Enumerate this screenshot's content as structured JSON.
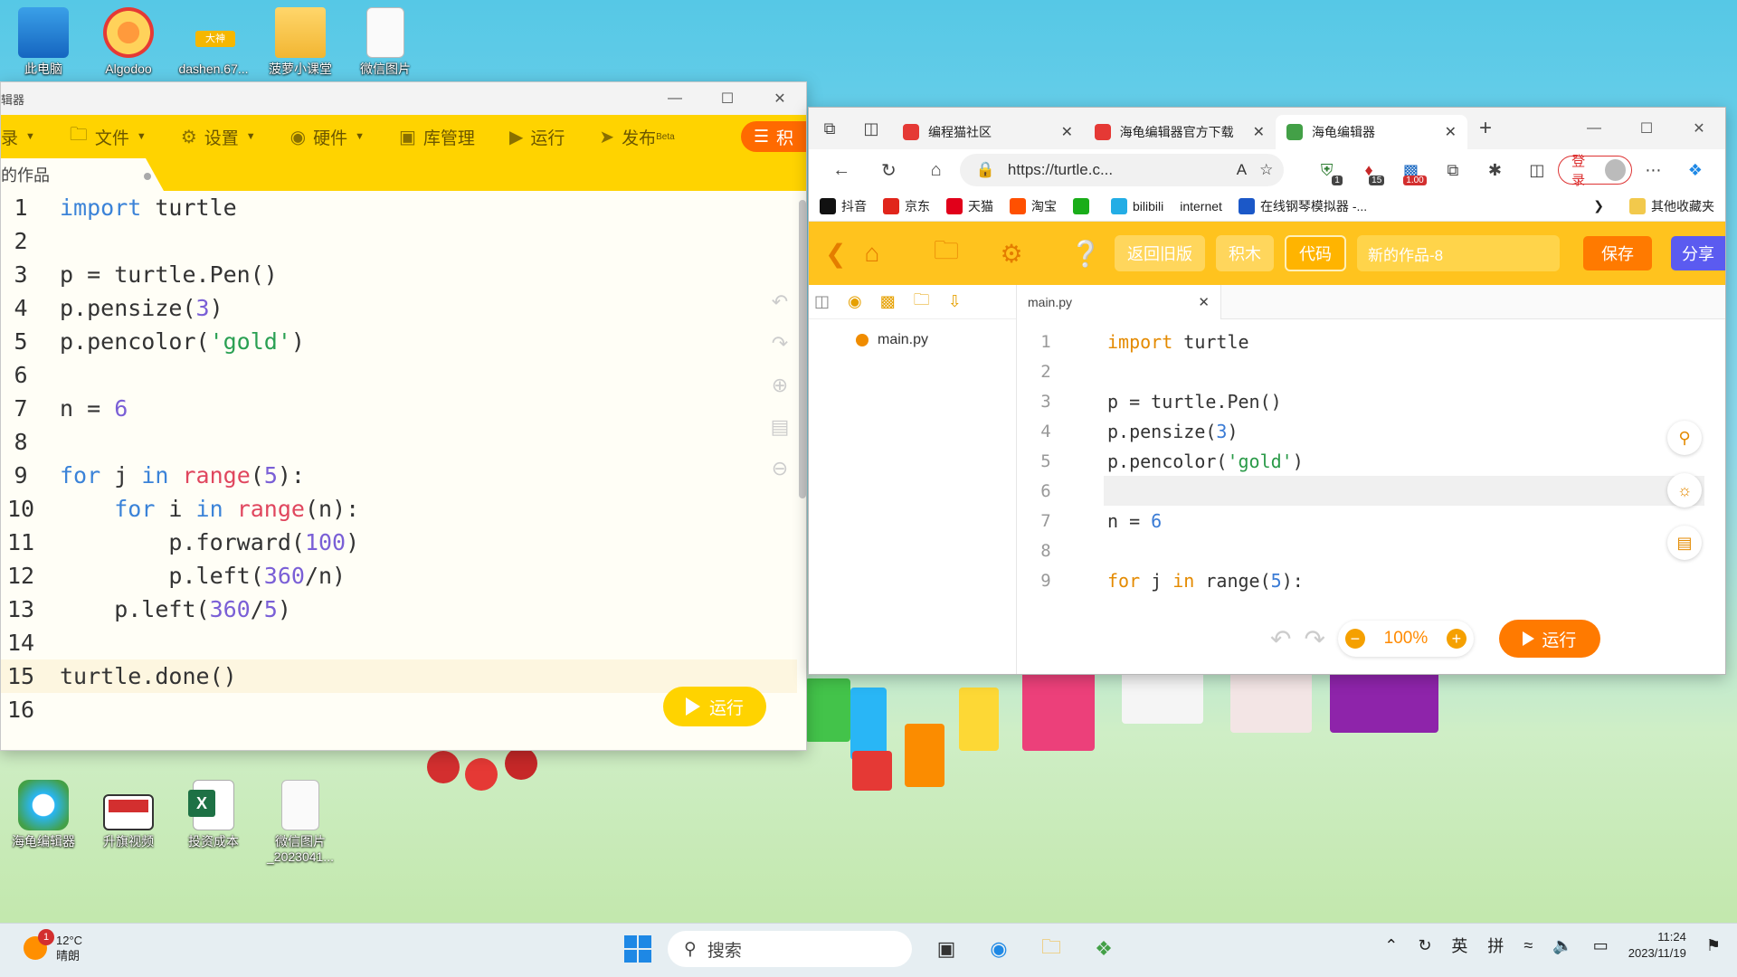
{
  "desktop": {
    "top_icons": [
      {
        "label": "此电脑"
      },
      {
        "label": "Algodoo"
      },
      {
        "label": "dashen.67..."
      },
      {
        "label": "菠萝小课堂"
      },
      {
        "label": "微信图片"
      }
    ],
    "bottom_icons": [
      {
        "label": "海龟编辑器"
      },
      {
        "label": "升旗视频"
      },
      {
        "label": "投资成本"
      },
      {
        "label": "微信图片_2023041..."
      }
    ]
  },
  "editor_window": {
    "title": "辑器",
    "menu": [
      {
        "label": "录",
        "icon": "login-icon",
        "caret": true
      },
      {
        "label": "文件",
        "icon": "folder-icon",
        "caret": true
      },
      {
        "label": "设置",
        "icon": "gear-icon",
        "caret": true
      },
      {
        "label": "硬件",
        "icon": "hardware-icon",
        "caret": true
      },
      {
        "label": "库管理",
        "icon": "library-icon",
        "caret": false
      },
      {
        "label": "运行",
        "icon": "play-icon",
        "caret": false
      },
      {
        "label": "发布",
        "icon": "send-icon",
        "caret": false
      }
    ],
    "publish_badge": "Beta",
    "share_label": "积",
    "tab_label": "的作品",
    "run_label": "运行",
    "code_lines": [
      "import turtle",
      "",
      "p = turtle.Pen()",
      "p.pensize(3)",
      "p.pencolor('gold')",
      "",
      "n = 6",
      "",
      "for j in range(5):",
      "    for i in range(n):",
      "        p.forward(100)",
      "        p.left(360/n)",
      "    p.left(360/5)",
      "",
      "turtle.done()",
      ""
    ],
    "highlighted_line": 15
  },
  "browser_window": {
    "tabs": [
      {
        "title": "编程猫社区",
        "active": false
      },
      {
        "title": "海龟编辑器官方下载",
        "active": false
      },
      {
        "title": "海龟编辑器",
        "active": true
      }
    ],
    "url": "https://turtle.c...",
    "read_aloud": "A",
    "extensions": [
      {
        "icon": "shield-extension-icon",
        "badge": "1"
      },
      {
        "icon": "fire-extension-icon",
        "badge": "15"
      },
      {
        "icon": "speed-extension-icon",
        "badge": "1.00"
      }
    ],
    "login_label": "登录",
    "bookmarks": [
      {
        "label": "抖音",
        "color": "#111111"
      },
      {
        "label": "京东",
        "color": "#e1251b"
      },
      {
        "label": "天猫",
        "color": "#e1001a"
      },
      {
        "label": "淘宝",
        "color": "#ff5000"
      },
      {
        "label": "",
        "color": "#1aad19"
      },
      {
        "label": "bilibili",
        "color": "#23ade5"
      },
      {
        "label": "internet",
        "color": ""
      },
      {
        "label": "在线钢琴模拟器 -...",
        "color": "#1b58c8"
      }
    ],
    "bookmarks_more": "其他收藏夹",
    "app": {
      "old_version": "返回旧版",
      "blocks": "积木",
      "code": "代码",
      "project_name": "新的作品-8",
      "save": "保存",
      "share": "分享",
      "file_name": "main.py",
      "tab_name": "main.py",
      "zoom": "100%",
      "run": "运行",
      "code_lines": [
        "import turtle",
        "",
        "p = turtle.Pen()",
        "p.pensize(3)",
        "p.pencolor('gold')",
        "",
        "n = 6",
        "",
        "for j in range(5):"
      ],
      "highlighted_line": 6
    }
  },
  "taskbar": {
    "temperature": "12°C",
    "weather": "晴朗",
    "weather_badge": "1",
    "search_placeholder": "搜索",
    "ime_lang": "英",
    "ime_mode": "拼",
    "time": "11:24",
    "date": "2023/11/19"
  },
  "colors": {
    "editor_accent": "#ffd300",
    "browser_app_accent": "#ffc31e",
    "run_orange": "#ff7a00"
  }
}
